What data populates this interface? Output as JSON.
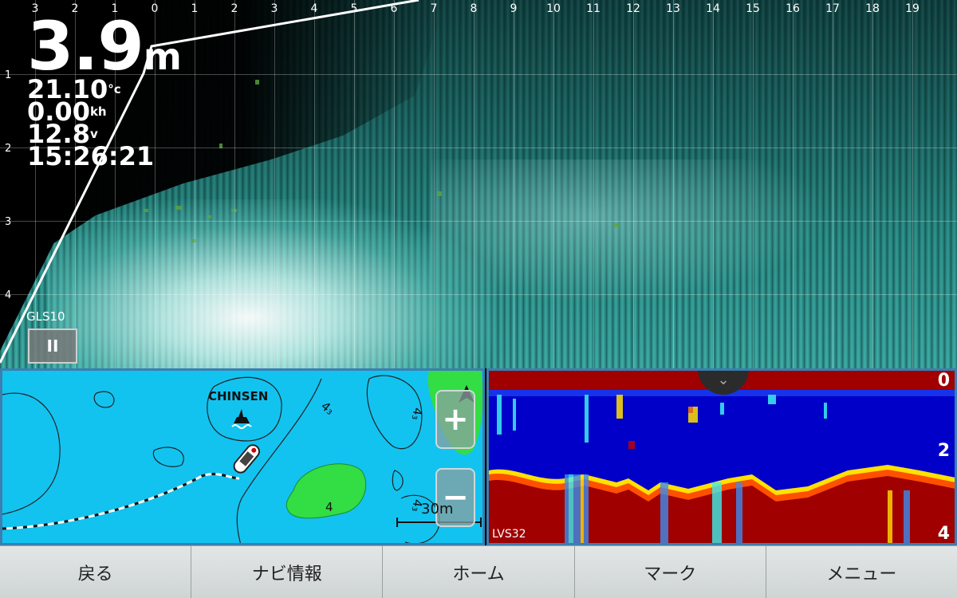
{
  "sonar": {
    "range_ticks": [
      "3",
      "2",
      "1",
      "0",
      "1",
      "2",
      "3",
      "4",
      "5",
      "6",
      "7",
      "8",
      "9",
      "10",
      "11",
      "12",
      "13",
      "14",
      "15",
      "16",
      "17",
      "18",
      "19"
    ],
    "depth_ticks": [
      "1",
      "2",
      "3",
      "4"
    ],
    "depth_value": "3.9",
    "depth_unit": "m",
    "water_temp": "21.10",
    "water_temp_unit": "°c",
    "speed": "0.00",
    "speed_unit": "kh",
    "voltage": "12.8",
    "voltage_unit": "v",
    "time": "15:26:21",
    "transducer_label": "GLS10",
    "pause_label": "II"
  },
  "map": {
    "place_name": "CHINSEN",
    "zoom_in_label": "+",
    "zoom_out_label": "−",
    "scale_label": "30m",
    "contour_labels": [
      "4₃",
      "4₃",
      "4",
      "4₃"
    ]
  },
  "fishfinder": {
    "label": "LVS32",
    "depth_labels": [
      "0",
      "2",
      "4"
    ],
    "collapse_icon": "chevron-double-down-icon"
  },
  "bottombar": {
    "buttons": [
      "戻る",
      "ナビ情報",
      "ホーム",
      "マーク",
      "メニュー"
    ]
  },
  "colors": {
    "sonar_teal": "#2a8c86",
    "map_water": "#12c3f0",
    "map_land": "#33dd44",
    "ff_water": "#0000c8",
    "ff_bottom": "#a00000"
  }
}
